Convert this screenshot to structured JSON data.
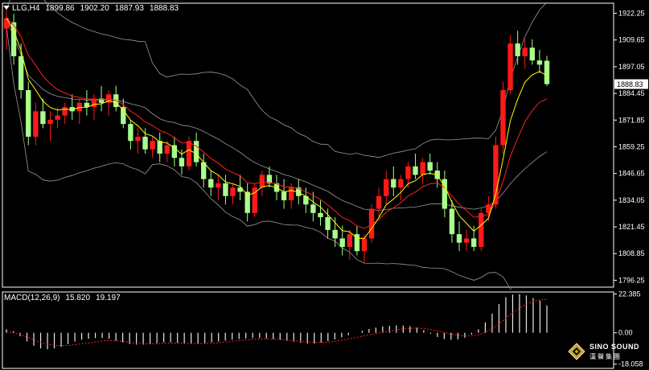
{
  "header": {
    "symbol": "LLG,H4",
    "open": "1899.86",
    "high": "1902.20",
    "low": "1887.93",
    "close": "1888.83"
  },
  "macd_header": {
    "label": "MACD(12,26,9)",
    "main": "15.820",
    "signal": "19.197"
  },
  "colors": {
    "background": "#000000",
    "bull": "#ff1a1a",
    "bear": "#a8ff8c",
    "fast_ma": "#ffff00",
    "slow_ma": "#ff2020",
    "bollinger": "#9a9a9a",
    "macd_signal": "#ff2020",
    "frame": "#ffffff"
  },
  "logo": {
    "line1": "SINO SOUND",
    "line2": "漢聲集團"
  },
  "chart_data": [
    {
      "type": "candlestick",
      "symbol": "LLG",
      "timeframe": "H4",
      "y_ticks": [
        "1922.25",
        "1909.65",
        "1897.05",
        "1884.45",
        "1871.85",
        "1859.25",
        "1846.65",
        "1834.05",
        "1821.45",
        "1808.85",
        "1796.25"
      ],
      "ylim": [
        1796.25,
        1928.0
      ],
      "current_price_label": "1888.83",
      "indicators": [
        "Bollinger Bands",
        "moving average (yellow)",
        "moving average (red)"
      ],
      "candles_ohlc_approx": [
        [
          1915,
          1925,
          1905,
          1920
        ],
        [
          1918,
          1922,
          1898,
          1902
        ],
        [
          1902,
          1908,
          1882,
          1886
        ],
        [
          1886,
          1890,
          1860,
          1864
        ],
        [
          1864,
          1880,
          1860,
          1876
        ],
        [
          1876,
          1882,
          1868,
          1870
        ],
        [
          1870,
          1876,
          1862,
          1872
        ],
        [
          1872,
          1878,
          1868,
          1874
        ],
        [
          1874,
          1880,
          1870,
          1878
        ],
        [
          1878,
          1884,
          1872,
          1876
        ],
        [
          1876,
          1882,
          1870,
          1880
        ],
        [
          1880,
          1886,
          1874,
          1878
        ],
        [
          1878,
          1884,
          1872,
          1882
        ],
        [
          1882,
          1888,
          1876,
          1880
        ],
        [
          1880,
          1886,
          1874,
          1884
        ],
        [
          1884,
          1888,
          1876,
          1878
        ],
        [
          1878,
          1882,
          1868,
          1870
        ],
        [
          1870,
          1872,
          1858,
          1862
        ],
        [
          1862,
          1868,
          1856,
          1864
        ],
        [
          1864,
          1868,
          1856,
          1858
        ],
        [
          1858,
          1864,
          1854,
          1862
        ],
        [
          1862,
          1866,
          1852,
          1856
        ],
        [
          1856,
          1862,
          1852,
          1860
        ],
        [
          1860,
          1864,
          1850,
          1854
        ],
        [
          1854,
          1858,
          1846,
          1850
        ],
        [
          1850,
          1864,
          1848,
          1862
        ],
        [
          1862,
          1866,
          1850,
          1852
        ],
        [
          1852,
          1856,
          1840,
          1844
        ],
        [
          1844,
          1848,
          1836,
          1840
        ],
        [
          1840,
          1846,
          1834,
          1842
        ],
        [
          1842,
          1846,
          1832,
          1836
        ],
        [
          1836,
          1842,
          1832,
          1840
        ],
        [
          1840,
          1846,
          1834,
          1838
        ],
        [
          1838,
          1842,
          1824,
          1828
        ],
        [
          1828,
          1842,
          1826,
          1840
        ],
        [
          1840,
          1848,
          1836,
          1846
        ],
        [
          1846,
          1850,
          1840,
          1842
        ],
        [
          1842,
          1846,
          1834,
          1838
        ],
        [
          1838,
          1844,
          1830,
          1834
        ],
        [
          1834,
          1842,
          1830,
          1840
        ],
        [
          1840,
          1844,
          1832,
          1836
        ],
        [
          1836,
          1840,
          1828,
          1832
        ],
        [
          1832,
          1838,
          1824,
          1828
        ],
        [
          1828,
          1834,
          1822,
          1826
        ],
        [
          1826,
          1830,
          1816,
          1820
        ],
        [
          1820,
          1826,
          1812,
          1816
        ],
        [
          1816,
          1822,
          1808,
          1812
        ],
        [
          1812,
          1820,
          1806,
          1818
        ],
        [
          1818,
          1822,
          1808,
          1810
        ],
        [
          1810,
          1818,
          1804,
          1816
        ],
        [
          1816,
          1832,
          1814,
          1830
        ],
        [
          1830,
          1840,
          1826,
          1836
        ],
        [
          1836,
          1848,
          1832,
          1844
        ],
        [
          1844,
          1850,
          1836,
          1840
        ],
        [
          1840,
          1846,
          1834,
          1844
        ],
        [
          1844,
          1852,
          1840,
          1850
        ],
        [
          1850,
          1856,
          1844,
          1846
        ],
        [
          1846,
          1854,
          1842,
          1852
        ],
        [
          1852,
          1856,
          1846,
          1848
        ],
        [
          1848,
          1852,
          1840,
          1844
        ],
        [
          1844,
          1848,
          1826,
          1830
        ],
        [
          1830,
          1834,
          1814,
          1818
        ],
        [
          1818,
          1824,
          1810,
          1814
        ],
        [
          1814,
          1820,
          1810,
          1816
        ],
        [
          1816,
          1822,
          1810,
          1812
        ],
        [
          1812,
          1830,
          1810,
          1828
        ],
        [
          1828,
          1836,
          1824,
          1832
        ],
        [
          1832,
          1864,
          1830,
          1860
        ],
        [
          1860,
          1890,
          1856,
          1886
        ],
        [
          1886,
          1912,
          1884,
          1908
        ],
        [
          1908,
          1914,
          1898,
          1902
        ],
        [
          1902,
          1910,
          1896,
          1906
        ],
        [
          1906,
          1910,
          1898,
          1900
        ],
        [
          1900,
          1905,
          1894,
          1898
        ],
        [
          1899.86,
          1902.2,
          1887.93,
          1888.83
        ]
      ]
    },
    {
      "type": "bar",
      "name": "MACD(12,26,9)",
      "main_value": 15.82,
      "signal_value": 19.197,
      "y_ticks": [
        "22.385",
        "0.00",
        "-18.058"
      ],
      "ylim": [
        -18.058,
        22.385
      ],
      "histogram_approx": [
        2.0,
        1.0,
        -2.0,
        -5.0,
        -7.5,
        -9.0,
        -9.5,
        -9.0,
        -8.0,
        -6.5,
        -5.0,
        -4.0,
        -3.5,
        -3.0,
        -3.0,
        -3.5,
        -4.5,
        -5.5,
        -6.5,
        -6.8,
        -6.8,
        -6.5,
        -6.0,
        -5.5,
        -5.5,
        -5.8,
        -6.2,
        -6.4,
        -6.4,
        -6.0,
        -5.5,
        -5.0,
        -4.5,
        -4.0,
        -3.6,
        -3.2,
        -3.0,
        -3.0,
        -3.2,
        -3.6,
        -4.0,
        -4.6,
        -5.2,
        -5.8,
        -6.2,
        -6.2,
        -5.6,
        -4.8,
        -3.8,
        -2.6,
        -1.4,
        0.0,
        1.2,
        2.2,
        3.0,
        3.6,
        4.0,
        4.2,
        4.2,
        3.8,
        3.0,
        1.4,
        -0.6,
        -2.4,
        -3.6,
        -4.0,
        -3.8,
        -2.8,
        -1.0,
        2.0,
        6.0,
        11.0,
        16.5,
        20.5,
        22.0,
        22.3,
        21.5,
        20.0,
        18.5,
        15.8
      ],
      "signal_approx": [
        0.5,
        0.0,
        -1.0,
        -2.5,
        -4.0,
        -5.5,
        -6.5,
        -7.2,
        -7.5,
        -7.3,
        -6.9,
        -6.3,
        -5.8,
        -5.2,
        -4.7,
        -4.5,
        -4.6,
        -5.0,
        -5.5,
        -6.0,
        -6.3,
        -6.4,
        -6.3,
        -6.1,
        -6.0,
        -6.0,
        -6.1,
        -6.2,
        -6.3,
        -6.2,
        -6.0,
        -5.7,
        -5.3,
        -4.9,
        -4.5,
        -4.1,
        -3.8,
        -3.6,
        -3.5,
        -3.6,
        -3.8,
        -4.1,
        -4.5,
        -4.9,
        -5.3,
        -5.6,
        -5.6,
        -5.4,
        -5.0,
        -4.3,
        -3.6,
        -2.8,
        -2.0,
        -1.2,
        -0.4,
        0.4,
        1.1,
        1.7,
        2.2,
        2.6,
        2.7,
        2.5,
        1.9,
        1.1,
        0.2,
        -0.7,
        -1.4,
        -1.8,
        -1.8,
        -1.2,
        0.2,
        2.3,
        5.0,
        8.5,
        11.6,
        14.3,
        16.5,
        18.0,
        18.9,
        19.197
      ]
    }
  ]
}
